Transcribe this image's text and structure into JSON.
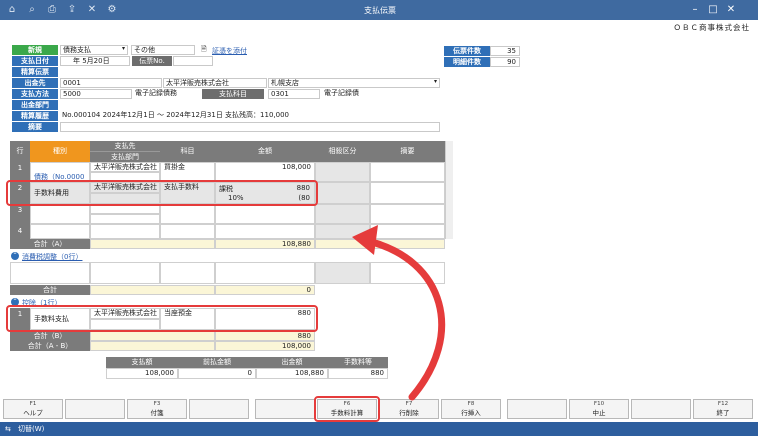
{
  "window": {
    "title": "支払伝票",
    "company": "ＯＢＣ商事株式会社"
  },
  "header": {
    "status_new": "新規",
    "type_value": "債務支払",
    "other_value": "その他",
    "attach_label": "証憑を添付",
    "date_label": "支払日付",
    "date_value": "年 5月20日",
    "slip_no_label": "伝票No.",
    "settle_label": "精算伝票",
    "payee_label": "出金先",
    "payee_code": "0001",
    "payee_name": "太平洋販売株式会社",
    "payee_branch": "札幌支店",
    "method_label": "支払方法",
    "method_code": "5000",
    "method_name": "電子記録債務",
    "account_label": "支払科目",
    "account_code": "0301",
    "account_name": "電子記録債",
    "dept_label": "出金部門",
    "history_label": "精算履歴",
    "history_value": "No.000104  2024年12月1日 ～ 2024年12月31日  支払残高：110,000",
    "memo_label": "摘要",
    "count_label": "伝票件数",
    "count_value": "35",
    "detail_label": "明細件数",
    "detail_value": "90"
  },
  "grid": {
    "headers": {
      "row": "行",
      "kind": "種別",
      "payee": "支払先",
      "dept": "支払部門",
      "account": "科目",
      "amount": "金額",
      "offset": "相殺区分",
      "memo": "摘要"
    },
    "rows": [
      {
        "no": "1",
        "kind": "債務（No.0000",
        "payee": "太平洋販売株式会社",
        "account": "買掛金",
        "amount": "108,000"
      },
      {
        "no": "2",
        "kind": "手数料費用",
        "payee": "太平洋販売株式会社",
        "account": "支払手数料",
        "tax": "課税",
        "amount": "880",
        "rate": "10%",
        "tax_amount": "(80"
      },
      {
        "no": "3"
      },
      {
        "no": "4"
      }
    ],
    "total_a_label": "合計（A）",
    "total_a_value": "108,880",
    "tax_section": "消費税調整（0行）",
    "tax_total_label": "合計",
    "tax_total_value": "0",
    "deduct_section": "控除（1行）",
    "deduct_row": {
      "no": "1",
      "kind": "手数料支払",
      "payee": "太平洋販売株式会社",
      "account": "当座預金",
      "amount": "880"
    },
    "total_b_label": "合計（B）",
    "total_b_value": "880",
    "total_ab_label": "合計（A - B）",
    "total_ab_value": "108,000"
  },
  "summary": {
    "headers": [
      "支払額",
      "前払金額",
      "出金額",
      "手数料等"
    ],
    "values": [
      "108,000",
      "0",
      "108,880",
      "880"
    ]
  },
  "fkeys": [
    {
      "key": "F1",
      "label": "ヘルプ"
    },
    {
      "key": "",
      "label": ""
    },
    {
      "key": "F3",
      "label": "付箋"
    },
    {
      "key": "",
      "label": ""
    },
    {
      "key": "",
      "label": ""
    },
    {
      "key": "F6",
      "label": "手数料計算"
    },
    {
      "key": "F7",
      "label": "行削除"
    },
    {
      "key": "F8",
      "label": "行挿入"
    },
    {
      "key": "",
      "label": ""
    },
    {
      "key": "F10",
      "label": "中止"
    },
    {
      "key": "",
      "label": ""
    },
    {
      "key": "F12",
      "label": "終了"
    }
  ],
  "statusbar": {
    "label": "切替(W)"
  },
  "colors": {
    "titlebar": "#3f6aa0",
    "highlight": "#e53b3b",
    "kind_header": "#f0961e",
    "label_blue": "#2f6fb7"
  }
}
